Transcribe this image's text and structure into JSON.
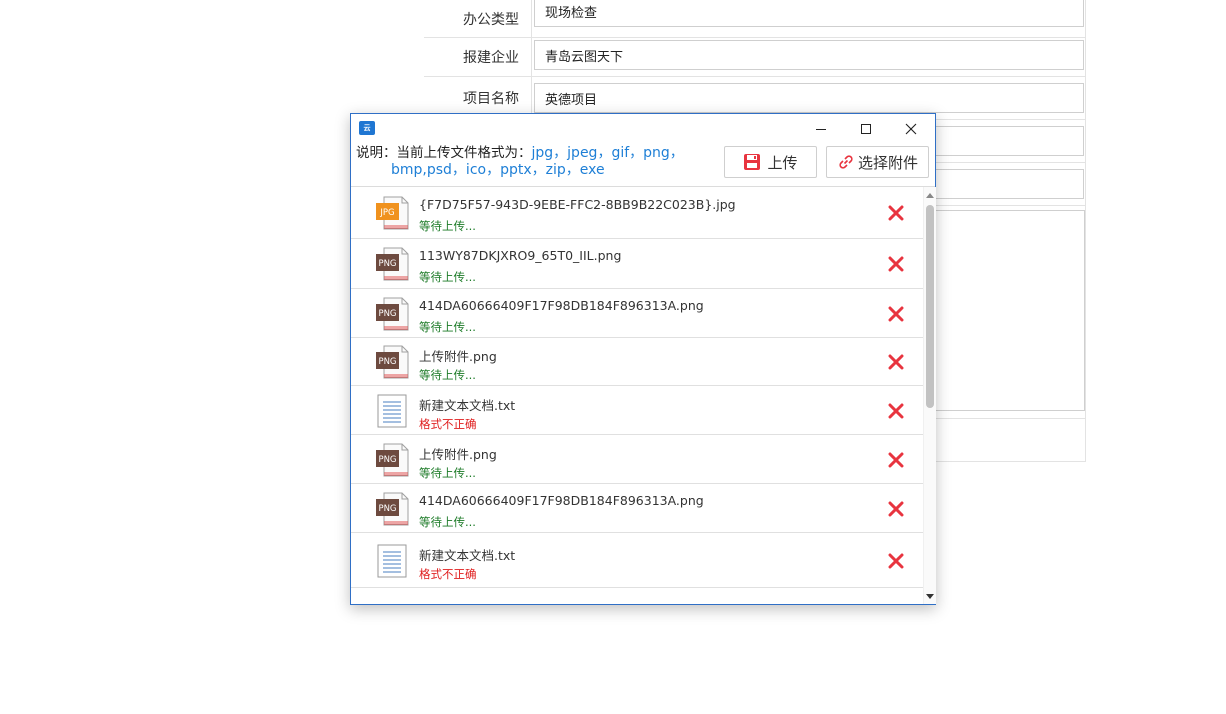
{
  "form": {
    "rows": [
      {
        "label": "办公类型",
        "value": "现场检查"
      },
      {
        "label": "报建企业",
        "value": "青岛云图天下"
      },
      {
        "label": "项目名称",
        "value": "英德项目"
      }
    ]
  },
  "dialog": {
    "app_icon": "yuntu-logo-icon",
    "info_prefix": "说明：当前上传文件格式为：",
    "formats_line1": "jpg，jpeg，gif，png，",
    "formats_line2": "bmp,psd，ico，pptx，zip，exe",
    "upload_label": "上传",
    "attach_label": "选择附件",
    "files": [
      {
        "name": "{F7D75F57-943D-9EBE-FFC2-8BB9B22C023B}.jpg",
        "status": "等待上传...",
        "type": "JPG"
      },
      {
        "name": "113WY87DKJXRO9_65T0_IIL.png",
        "status": "等待上传...",
        "type": "PNG"
      },
      {
        "name": "414DA60666409F17F98DB184F896313A.png",
        "status": "等待上传...",
        "type": "PNG"
      },
      {
        "name": "上传附件.png",
        "status": "等待上传...",
        "type": "PNG"
      },
      {
        "name": "新建文本文档.txt",
        "status": "格式不正确",
        "type": "TXT"
      },
      {
        "name": "上传附件.png",
        "status": "等待上传...",
        "type": "PNG"
      },
      {
        "name": "414DA60666409F17F98DB184F896313A.png",
        "status": "等待上传...",
        "type": "PNG"
      },
      {
        "name": "新建文本文档.txt",
        "status": "格式不正确",
        "type": "TXT"
      }
    ]
  },
  "colors": {
    "accent": "#1e7fd6",
    "wait": "#1b7a26",
    "error": "#e02020",
    "delete": "#e8343f",
    "jpg_icon": "#f0921e",
    "png_icon": "#6d4a3f"
  }
}
